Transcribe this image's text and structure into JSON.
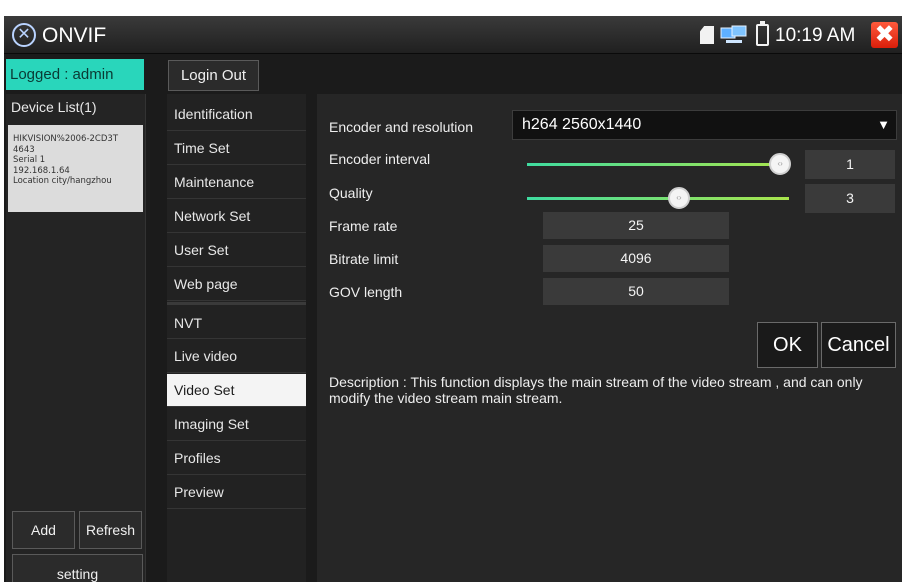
{
  "title_bar": {
    "app_title": "ONVIF",
    "clock": "10:19 AM",
    "icons": [
      "onvif-app-icon",
      "sd-card-icon",
      "network-icon",
      "battery-icon",
      "close-icon"
    ],
    "close_symbol": "✖"
  },
  "session": {
    "logged_label": "Logged : admin",
    "login_out_label": "Login Out"
  },
  "device_list": {
    "title": "Device List(1)",
    "devices": [
      {
        "model": "HIKVISION%2006-2CD3T",
        "model_line2": "4643",
        "serial": "Serial 1",
        "ip": "192.168.1.64",
        "location": "Location city/hangzhou"
      }
    ],
    "add_label": "Add",
    "refresh_label": "Refresh",
    "setting_label": "setting"
  },
  "menu": {
    "items": [
      {
        "label": "Identification"
      },
      {
        "label": "Time Set"
      },
      {
        "label": "Maintenance"
      },
      {
        "label": "Network Set"
      },
      {
        "label": "User Set"
      },
      {
        "label": "Web page"
      },
      {
        "label": "NVT"
      },
      {
        "label": "Live video"
      },
      {
        "label": "Video Set",
        "active": true
      },
      {
        "label": "Imaging Set"
      },
      {
        "label": "Profiles"
      },
      {
        "label": "Preview"
      }
    ]
  },
  "video_set": {
    "encoder_label": "Encoder and resolution",
    "encoder_value": "h264 2560x1440",
    "interval_label": "Encoder interval",
    "interval_value": "1",
    "interval_level": 1.0,
    "quality_label": "Quality",
    "quality_value": "3",
    "quality_level": 0.6,
    "frame_rate_label": "Frame rate",
    "frame_rate_value": "25",
    "bitrate_label": "Bitrate limit",
    "bitrate_value": "4096",
    "gov_label": "GOV length",
    "gov_value": "50",
    "ok_label": "OK",
    "cancel_label": "Cancel",
    "description": "Description : This function displays the main stream of the video stream , and can only modify the video stream main stream."
  },
  "colors": {
    "logged_badge": "#29d6bb",
    "close_button": "#e0321a",
    "slider_start": "#3fdca0",
    "slider_end": "#a9e54c"
  }
}
